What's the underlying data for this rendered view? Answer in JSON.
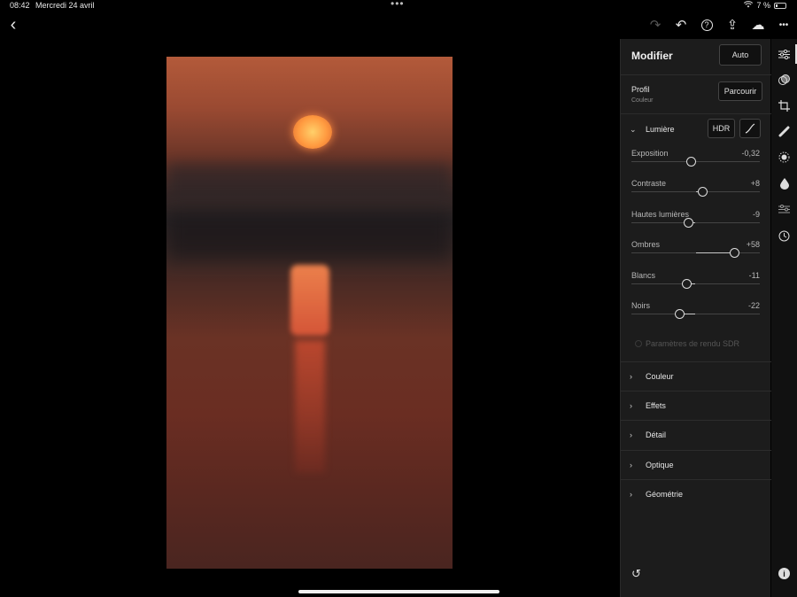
{
  "status_bar": {
    "time": "08:42",
    "date": "Mercredi 24 avril",
    "multitask_dots": "•••",
    "wifi_icon": "wifi-icon",
    "battery": "7 %",
    "battery_icon": "battery-charging-icon"
  },
  "toolbar": {
    "back_icon": "chevron-left-icon",
    "redo_icon": "redo-icon",
    "undo_icon": "undo-icon",
    "help_icon": "help-icon",
    "share_icon": "share-icon",
    "cloud_icon": "cloud-sync-icon",
    "more_icon": "more-icon",
    "back_glyph": "‹",
    "redo_glyph": "↷",
    "undo_glyph": "↶",
    "help_glyph": "?",
    "share_glyph": "⇪",
    "cloud_glyph": "☁",
    "more_glyph": "•••"
  },
  "panel": {
    "title": "Modifier",
    "auto_button": "Auto",
    "profile": {
      "label": "Profil",
      "value": "Couleur",
      "browse_button": "Parcourir"
    },
    "light": {
      "title": "Lumière",
      "expanded": true,
      "hdr_button": "HDR",
      "curve_icon": "tone-curve-icon",
      "sliders": [
        {
          "name": "Exposition",
          "value": "-0,32",
          "position": 0.46
        },
        {
          "name": "Contraste",
          "value": "+8",
          "position": 0.55
        },
        {
          "name": "Hautes lumières",
          "value": "-9",
          "position": 0.44
        },
        {
          "name": "Ombres",
          "value": "+58",
          "position": 0.8
        },
        {
          "name": "Blancs",
          "value": "-11",
          "position": 0.43
        },
        {
          "name": "Noirs",
          "value": "-22",
          "position": 0.37
        }
      ],
      "sdr_option": "Paramètres de rendu SDR"
    },
    "sections": [
      {
        "title": "Couleur"
      },
      {
        "title": "Effets"
      },
      {
        "title": "Détail"
      },
      {
        "title": "Optique"
      },
      {
        "title": "Géométrie"
      }
    ],
    "reset_icon": "reset-icon"
  },
  "rail": {
    "icons": [
      "edit-sliders-icon",
      "presets-icon",
      "crop-icon",
      "healing-icon",
      "masking-icon",
      "color-drop-icon",
      "versions-icon",
      "history-icon"
    ],
    "info_icon": "info-icon",
    "info_glyph": "i"
  },
  "colors": {
    "panel_bg": "#1c1c1c",
    "rail_bg": "#111111",
    "canvas_bg": "#000000",
    "accent": "#e0e0e0"
  }
}
